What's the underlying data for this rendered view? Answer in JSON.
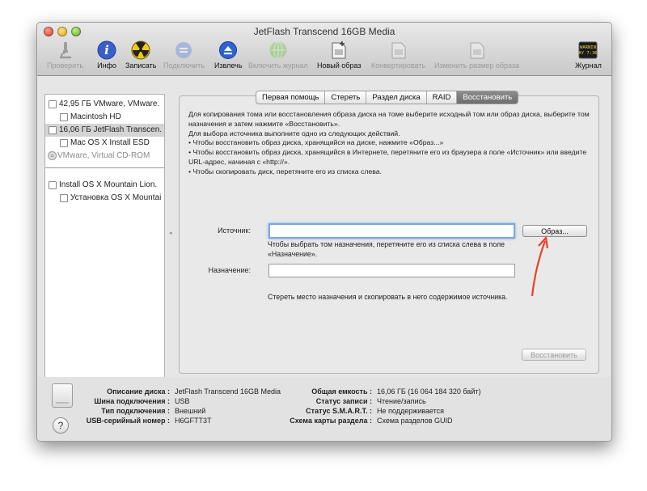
{
  "window": {
    "title": "JetFlash Transcend 16GB Media"
  },
  "toolbar": {
    "verify": "Проверить",
    "info": "Инфо",
    "burn": "Записать",
    "mount": "Подключить",
    "eject": "Извлечь",
    "enable_journal": "Включить журнал",
    "new_image": "Новый образ",
    "convert": "Конвертировать",
    "resize_image": "Изменить размер образа",
    "log": "Журнал",
    "log_icon_line1": "WARNIN",
    "log_icon_line2": "AY 7:36"
  },
  "sidebar": {
    "items": [
      {
        "label": "42,95 ГБ VMware, VMware."
      },
      {
        "label": "Macintosh HD"
      },
      {
        "label": "16,06 ГБ JetFlash Transcen."
      },
      {
        "label": "Mac OS X Install ESD"
      },
      {
        "label": "VMware, Virtual CD-ROM"
      },
      {
        "label": "Install OS X Mountain Lion."
      },
      {
        "label": "Установка OS X Mountai"
      }
    ]
  },
  "tabs": {
    "first_aid": "Первая помощь",
    "erase": "Стереть",
    "partition": "Раздел диска",
    "raid": "RAID",
    "restore": "Восстановить"
  },
  "instructions": {
    "p1": "Для копирования тома или восстановления образа диска на томе выберите исходный том или образ диска, выберите том назначения и затем нажмите «Восстановить».",
    "p2": "Для выбора источника выполните одно из следующих действий.",
    "b1": "•     Чтобы восстановить образ диска, хранящийся на диске, нажмите «Образ...»",
    "b2": "•     Чтобы восстановить образ диска, хранящийся в Интернете, перетяните его из браузера в поле «Источник» или введите URL-адрес, начиная с «http://».",
    "b3": "•     Чтобы скопировать диск, перетяните его из списка слева."
  },
  "restore": {
    "source_label": "Источник:",
    "source_value": "",
    "image_button": "Образ...",
    "source_hint": "Чтобы выбрать том назначения, перетяните его из списка слева в поле «Назначение».",
    "destination_label": "Назначение:",
    "destination_value": "",
    "erase_hint": "Стереть место назначения и скопировать в него содержимое источника.",
    "restore_button": "Восстановить"
  },
  "disk_info": {
    "desc_key": "Описание диска :",
    "desc_val": "JetFlash Transcend 16GB Media",
    "conn_key": "Шина подключения :",
    "conn_val": "USB",
    "type_key": "Тип подключения :",
    "type_val": "Внешний",
    "serial_key": "USB-серийный номер :",
    "serial_val": "H6GFTT3T",
    "cap_key": "Общая емкость :",
    "cap_val": "16,06 ГБ (16 064 184 320 байт)",
    "write_key": "Статус записи :",
    "write_val": "Чтение/запись",
    "smart_key": "Статус S.M.A.R.T. :",
    "smart_val": "Не поддерживается",
    "map_key": "Схема карты раздела :",
    "map_val": "Схема разделов GUID"
  },
  "help": {
    "label": "?"
  },
  "colors": {
    "annotation_arrow": "#e8412c",
    "focus_ring": "#7aa7e0"
  }
}
